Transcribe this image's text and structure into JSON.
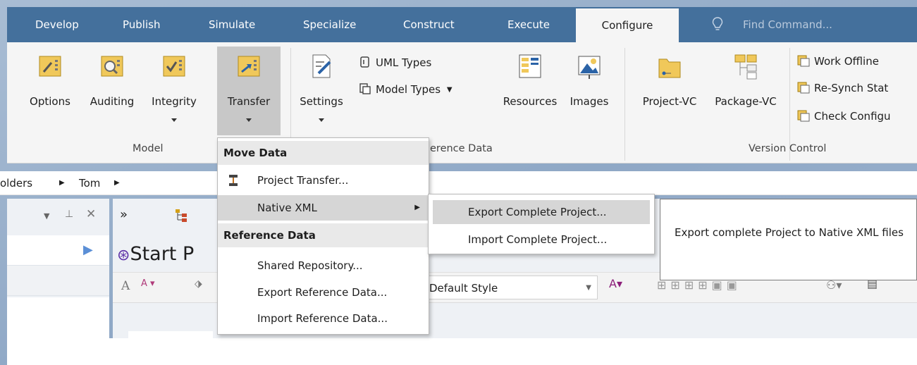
{
  "tabs": [
    "Develop",
    "Publish",
    "Simulate",
    "Specialize",
    "Construct",
    "Execute",
    "Configure"
  ],
  "active_tab": "Configure",
  "find_command": {
    "placeholder": "Find Command..."
  },
  "ribbon": {
    "model": {
      "label": "Model",
      "buttons": [
        "Options",
        "Auditing",
        "Integrity",
        "Transfer"
      ]
    },
    "reference_data": {
      "label_visible": "erence Data",
      "settings": "Settings",
      "uml_types": "UML Types",
      "model_types": "Model Types",
      "resources": "Resources",
      "images": "Images"
    },
    "version_control": {
      "label": "Version Control",
      "project_vc": "Project-VC",
      "package_vc": "Package-VC",
      "work_offline": "Work Offline",
      "resynch": "Re-Synch Stat",
      "check_config": "Check Configu"
    }
  },
  "breadcrumb": {
    "part1": "olders",
    "part2": "Tom"
  },
  "dropdown": {
    "header_move": "Move Data",
    "project_transfer": "Project Transfer...",
    "native_xml": "Native XML",
    "header_reference": "Reference Data",
    "shared_repository": "Shared Repository...",
    "export_reference": "Export Reference Data...",
    "import_reference": "Import Reference Data..."
  },
  "submenu": {
    "export_complete": "Export Complete Project...",
    "import_complete": "Import Complete Project..."
  },
  "tooltip": {
    "text": "Export complete Project to Native XML files"
  },
  "workspace": {
    "start_page_title": "Start P",
    "style_select": "Default Style"
  },
  "colors": {
    "tabbar": "#44709c",
    "ribbon": "#f5f5f5",
    "highlight": "#d6d6d6",
    "background": "#9db3cf"
  }
}
